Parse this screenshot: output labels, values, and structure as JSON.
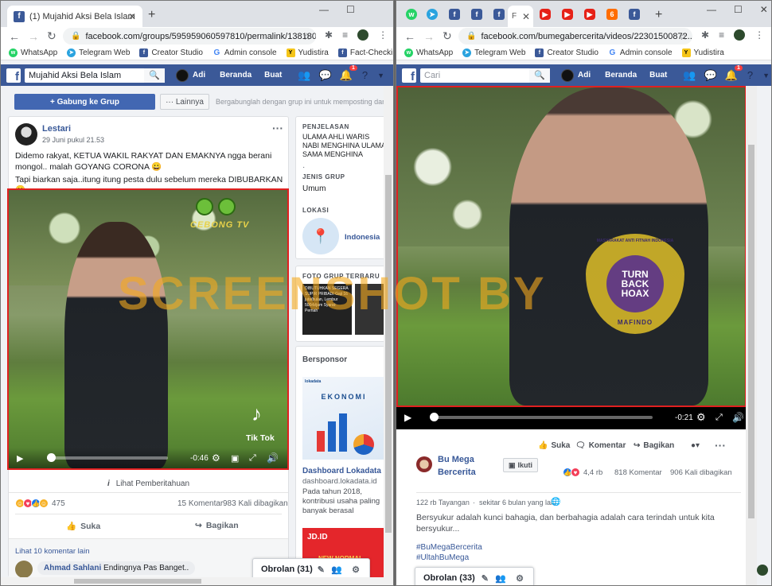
{
  "left": {
    "tab": {
      "title": "(1) Mujahid Aksi Bela Islam"
    },
    "url": "facebook.com/groups/595959060597810/permalink/138180...",
    "bookmarks": [
      "WhatsApp",
      "Telegram Web",
      "Creator Studio",
      "Admin console",
      "Yudistira",
      "Fact-Checking"
    ],
    "fb": {
      "search_value": "Mujahid Aksi Bela Islam",
      "user": "Adi",
      "home": "Beranda",
      "create": "Buat",
      "notif_count": "1"
    },
    "group_bar": {
      "join": "+ Gabung ke Grup",
      "more": "··· Lainnya",
      "hint": "Bergabunglah dengan grup ini untuk memposting dan ber"
    },
    "post": {
      "author": "Lestari",
      "time": "29 Juni pukul 21.53",
      "text1": "Didemo rakyat, KETUA WAKIL RAKYAT DAN EMAKNYA ngga berani mongol.. malah GOYANG CORONA 😀",
      "text2": "Tapi biarkan saja..itung itung pesta dulu sebelum mereka DIBUBARKAN 😀",
      "video_sticker": "CEBONG TV",
      "tiktok": "Tik Tok",
      "time_left": "-0:46",
      "notice": "Lihat Pemberitahuan",
      "reaction_count": "475",
      "comments": "15 Komentar",
      "shares": "983 Kali dibagikan",
      "like": "Suka",
      "share": "Bagikan",
      "more_comments": "Lihat 10 komentar lain",
      "commenter": "Ahmad Sahlani",
      "comment": "Endingnya Pas Banget.."
    },
    "sidebar": {
      "desc_label": "PENJELASAN",
      "desc": "ULAMA AHLI WARIS NABI MENGHINA ULAMA SAMA MENGHINA NABI............",
      "type_label": "JENIS GRUP",
      "type": "Umum",
      "loc_label": "LOKASI",
      "location": "Indonesia",
      "photos_label": "FOTO GRUP TERBARU",
      "photo_text": "DIBUTUHKAN SEGERA SUPIR PRIBADI Gaji 16 juta/bulan, Lembur 500rb/jam Syarat: Pernah",
      "sponsor_label": "Bersponsor",
      "ad_brand": "lokadata",
      "ad_image_title": "EKONOMI",
      "ad_title": "Dashboard Lokadata",
      "ad_domain": "dashboard.lokadata.id",
      "ad_text": "Pada tahun 2018, kontribusi usaha paling banyak berasal Pengola...",
      "ad2_brand": "JD.ID",
      "ad2_text": "NEW NORMAL"
    },
    "chat": "Obrolan (31)",
    "watermark": "SCREENSHOT BY"
  },
  "right": {
    "tab": {
      "title": "F"
    },
    "url": "facebook.com/bumegabercerita/videos/22301500872...",
    "bookmarks": [
      "WhatsApp",
      "Telegram Web",
      "Creator Studio",
      "Admin console",
      "Yudistira"
    ],
    "fb": {
      "search_placeholder": "Cari",
      "user": "Adi",
      "home": "Beranda",
      "create": "Buat",
      "notif_count": "1"
    },
    "stamp": {
      "line1": "TURN",
      "line2": "BACK",
      "line3": "HOAX",
      "ring_top": "MASYARAKAT ANTI FITNAH INDONESIA",
      "ring_bottom": "MAFINDO"
    },
    "time_left": "-0:21",
    "actions": {
      "like": "Suka",
      "comment": "Komentar",
      "share": "Bagikan"
    },
    "page": {
      "name": "Bu Mega Bercerita",
      "follow": "Ikuti"
    },
    "reactions": "4,4 rb",
    "comments": "818 Komentar",
    "shares": "906 Kali dibagikan",
    "views": "122 rb Tayangan",
    "time": "sekitar 6 bulan yang lalu",
    "desc": "Bersyukur adalah kunci bahagia, dan berbahagia adalah cara terindah untuk kita bersyukur...",
    "tag1": "#BuMegaBercerita",
    "tag2": "#UltahBuMega",
    "chat": "Obrolan (33)"
  }
}
